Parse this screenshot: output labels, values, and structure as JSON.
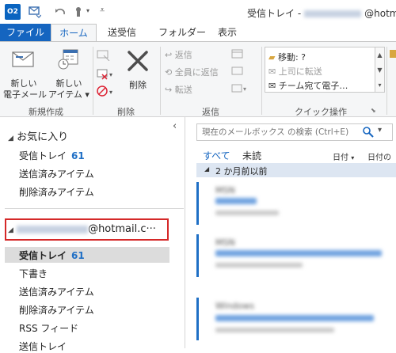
{
  "titlebar": {
    "app_badge": "O2",
    "title_prefix": "受信トレイ -",
    "title_suffix": "@hotmail"
  },
  "tabs": {
    "file": "ファイル",
    "home": "ホーム",
    "send_receive": "送受信",
    "folder": "フォルダー",
    "view": "表示"
  },
  "ribbon": {
    "new_email": [
      "新しい",
      "電子メール"
    ],
    "new_items": [
      "新しい",
      "アイテム"
    ],
    "delete": "削除",
    "reply": "返信",
    "reply_all": "全員に返信",
    "forward": "転送",
    "quick_steps": {
      "move": "移動: ?",
      "to_manager": "上司に転送",
      "team_email": "チーム宛て電子…"
    },
    "groups": {
      "new": "新規作成",
      "delete": "削除",
      "respond": "返信",
      "quick_steps": "クイック操作"
    }
  },
  "nav": {
    "collapse_glyph": "‹",
    "favorites": {
      "title": "お気に入り",
      "items": [
        {
          "label": "受信トレイ",
          "count": "61"
        },
        {
          "label": "送信済みアイテム"
        },
        {
          "label": "削除済みアイテム"
        }
      ]
    },
    "account": {
      "email_suffix": "@hotmail.c···",
      "items": [
        {
          "label": "受信トレイ",
          "count": "61"
        },
        {
          "label": "下書き"
        },
        {
          "label": "送信済みアイテム"
        },
        {
          "label": "削除済みアイテム"
        },
        {
          "label": "RSS フィード"
        },
        {
          "label": "送信トレイ"
        }
      ]
    }
  },
  "maillist": {
    "search_placeholder": "現在のメールボックス の検索 (Ctrl+E)",
    "filter_all": "すべて",
    "filter_unread": "未読",
    "sort_date": "日付",
    "sort_date_order": "日付の",
    "group_header": "2 か月前以前",
    "senders": [
      "MSN",
      "MSN",
      "Windows"
    ]
  },
  "colors": {
    "accent": "#1565c0",
    "count": "#1f6fc5",
    "highlight": "#d52828",
    "group_header_bg": "#dde6f2"
  }
}
